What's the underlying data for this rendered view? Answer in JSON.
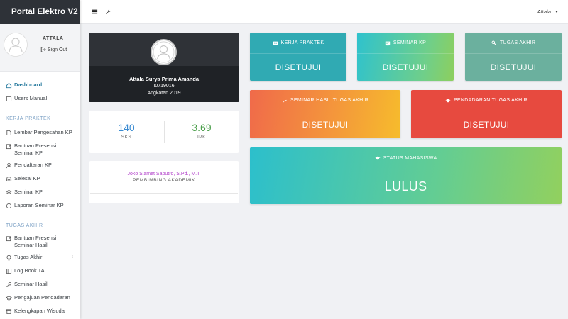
{
  "app": {
    "title": "Portal Elektro V2"
  },
  "topbar": {
    "user": "Attala"
  },
  "sidebar": {
    "user_name": "ATTALA",
    "signout_label": "Sign Out",
    "dashboard": "Dashboard",
    "users_manual": "Users Manual",
    "kp_header": "KERJA PRAKTEK",
    "kp_items": [
      "Lembar Pengesahan KP",
      "Bantuan Presensi Seminar KP",
      "Pendaftaran KP",
      "Selesai KP",
      "Seminar KP",
      "Laporan Seminar KP"
    ],
    "ta_header": "TUGAS AKHIR",
    "ta_items": [
      "Bantuan Presensi Seminar Hasil",
      "Tugas Akhir",
      "Log Book TA",
      "Seminar Hasil",
      "Pengajuan Pendadaran",
      "Kelengkapan Wisuda"
    ]
  },
  "profile": {
    "name": "Attala Surya Prima Amanda",
    "nim": "I0719016",
    "angkatan": "Angkatan 2019"
  },
  "stats": {
    "sks_value": "140",
    "sks_label": "SKS",
    "ipk_value": "3.69",
    "ipk_label": "IPK"
  },
  "advisor": {
    "name": "Joko Slamet Saputro, S.Pd., M.T.",
    "role": "PEMBIMBING AKADEMIK"
  },
  "status_boxes": {
    "kerja_praktek": {
      "title": "KERJA PRAKTEK",
      "value": "DISETUJUI"
    },
    "seminar_kp": {
      "title": "SEMINAR KP",
      "value": "DISETUJUI"
    },
    "tugas_akhir": {
      "title": "TUGAS AKHIR",
      "value": "DISETUJUI"
    },
    "seminar_hasil": {
      "title": "SEMINAR HASIL TUGAS AKHIR",
      "value": "DISETUJUI"
    },
    "pendadaran": {
      "title": "PENDADARAN TUGAS AKHIR",
      "value": "DISETUJUI"
    },
    "status_mahasiswa": {
      "title": "STATUS MAHASISWA",
      "value": "LULUS"
    }
  },
  "icons": {
    "menu": "hamburger-icon",
    "settings": "wrench-icon",
    "signout": "sign-out-icon",
    "kp": "id-card-icon",
    "seminar": "chalkboard-icon",
    "ta": "key-icon",
    "seminar_hasil": "wrench-icon",
    "pendadaran": "graduation-cap-icon",
    "status": "graduation-cap-icon"
  },
  "colors": {
    "sidebar_brand": "#2e3238",
    "active_nav": "#2c7da0",
    "sks": "#3a8bd1",
    "ipk": "#4a9e4a",
    "advisor_name": "#b140c9"
  }
}
